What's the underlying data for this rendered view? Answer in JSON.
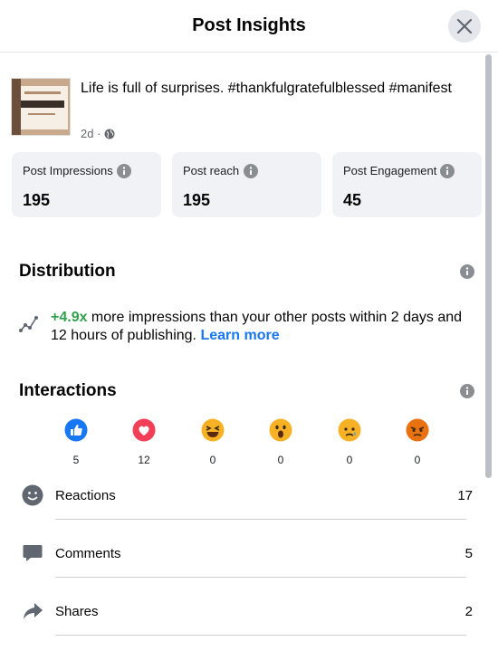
{
  "header": {
    "title": "Post Insights"
  },
  "post": {
    "text": "Life is full of surprises. #thankfulgratefulblessed #manifest",
    "time": "2d ·"
  },
  "stats": [
    {
      "label": "Post Impressions",
      "value": "195"
    },
    {
      "label": "Post reach",
      "value": "195"
    },
    {
      "label": "Post Engagement",
      "value": "45"
    }
  ],
  "distribution": {
    "title": "Distribution",
    "multiplier": "+4.9x",
    "text": " more impressions than your other posts within 2 days and 12 hours of publishing. ",
    "link": "Learn more"
  },
  "interactions": {
    "title": "Interactions",
    "reactions": [
      {
        "name": "like",
        "count": "5",
        "color": "#1877f2"
      },
      {
        "name": "love",
        "count": "12",
        "color": "#f33e58"
      },
      {
        "name": "haha",
        "count": "0",
        "color": "#f7b125"
      },
      {
        "name": "wow",
        "count": "0",
        "color": "#f7b125"
      },
      {
        "name": "sad",
        "count": "0",
        "color": "#f7b125"
      },
      {
        "name": "angry",
        "count": "0",
        "color": "#e9710f"
      }
    ],
    "rows": [
      {
        "label": "Reactions",
        "value": "17"
      },
      {
        "label": "Comments",
        "value": "5"
      },
      {
        "label": "Shares",
        "value": "2"
      }
    ]
  }
}
